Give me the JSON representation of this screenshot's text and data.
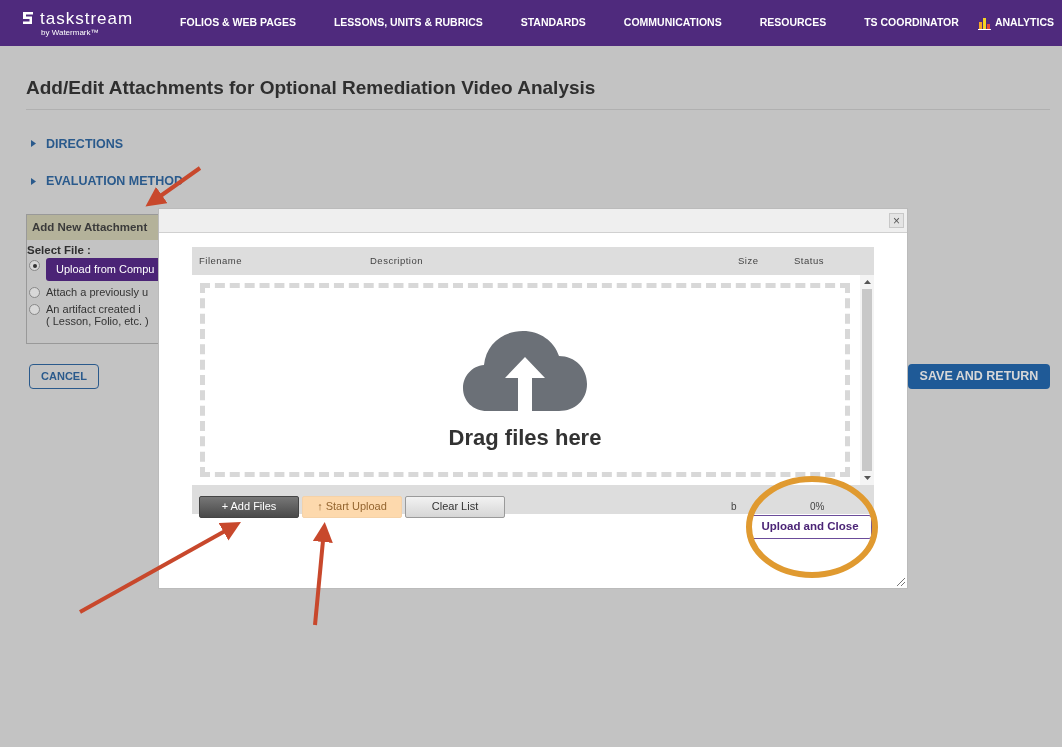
{
  "header": {
    "logo": "taskstream",
    "logo_sub": "by Watermark™",
    "nav": [
      {
        "label": "FOLIOS & WEB PAGES"
      },
      {
        "label": "LESSONS, UNITS & RUBRICS"
      },
      {
        "label": "STANDARDS"
      },
      {
        "label": "COMMUNICATIONS"
      },
      {
        "label": "RESOURCES"
      },
      {
        "label": "TS COORDINATOR"
      }
    ],
    "analytics": "ANALYTICS"
  },
  "page": {
    "title": "Add/Edit Attachments for Optional Remediation Video Analysis",
    "sections": [
      {
        "label": "DIRECTIONS",
        "expanded": false
      },
      {
        "label": "EVALUATION METHOD",
        "expanded": false
      }
    ],
    "attachment_panel": {
      "title": "Add New Attachment",
      "select_label": "Select File :",
      "options": [
        {
          "kind": "button",
          "label": "Upload from Compu",
          "selected": true
        },
        {
          "kind": "text",
          "label": "Attach a previously u",
          "selected": false
        },
        {
          "kind": "text",
          "label": "An artifact created i",
          "note": "( Lesson, Folio, etc. )",
          "selected": false
        }
      ]
    },
    "cancel": "CANCEL",
    "save": "SAVE AND RETURN"
  },
  "dialog": {
    "close": "×",
    "columns": [
      "Filename",
      "Description",
      "Size",
      "Status"
    ],
    "drop_text": "Drag files here",
    "buttons": [
      {
        "kind": "dark",
        "label": "+ Add Files"
      },
      {
        "kind": "disabled",
        "label": "↑ Start Upload"
      },
      {
        "kind": "plain",
        "label": "Clear List"
      }
    ],
    "footer_cells": [
      "b",
      "0%"
    ],
    "upload_close": "Upload and Close"
  }
}
